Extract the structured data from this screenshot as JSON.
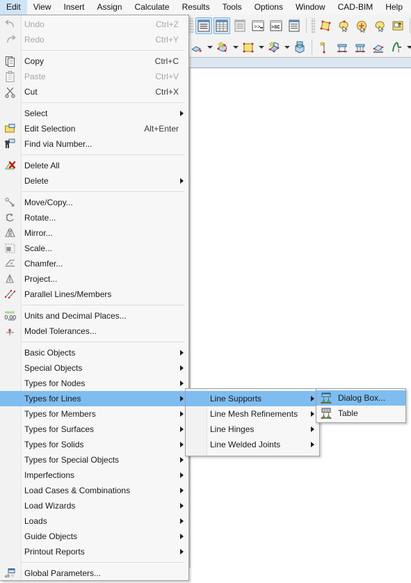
{
  "menubar": {
    "items": [
      {
        "label": "Edit",
        "active": true
      },
      {
        "label": "View",
        "active": false
      },
      {
        "label": "Insert",
        "active": false
      },
      {
        "label": "Assign",
        "active": false
      },
      {
        "label": "Calculate",
        "active": false
      },
      {
        "label": "Results",
        "active": false
      },
      {
        "label": "Tools",
        "active": false
      },
      {
        "label": "Options",
        "active": false
      },
      {
        "label": "Window",
        "active": false
      },
      {
        "label": "CAD-BIM",
        "active": false
      },
      {
        "label": "Help",
        "active": false
      }
    ]
  },
  "colors": {
    "menu_highlight": "#7fbdf0",
    "menubar_active": "#cfe4f7",
    "menu_background": "#f7f7f7",
    "toolbar_selected": "#d6eaf8",
    "ribbon_band": "#dce7f1",
    "disabled_text": "#a6a6a6"
  },
  "toolbar": {
    "row1": [
      {
        "name": "navigator-panel-button",
        "selected": true
      },
      {
        "name": "tables-panel-button",
        "selected": true
      },
      {
        "name": "display-properties-button",
        "selected": false
      },
      {
        "name": "command-line-button",
        "selected": false
      },
      {
        "name": "script-console-button",
        "selected": false
      },
      {
        "name": "printout-report-button",
        "selected": false
      },
      {
        "name": "select-area-button",
        "selected": false
      },
      {
        "name": "select-special-button",
        "selected": false
      },
      {
        "name": "select-objects-button",
        "selected": false
      },
      {
        "name": "deselect-button",
        "selected": false
      },
      {
        "name": "edit-selection-button",
        "selected": false
      },
      {
        "name": "new-support-button",
        "selected": false
      }
    ],
    "row2": [
      {
        "name": "new-node-button",
        "selected": false
      },
      {
        "name": "new-line-button",
        "selected": false
      },
      {
        "name": "new-surface-button",
        "selected": false
      },
      {
        "name": "new-member-button",
        "selected": false
      },
      {
        "name": "new-solid-button",
        "selected": false
      },
      {
        "name": "new-nodal-support-button",
        "selected": false
      },
      {
        "name": "new-line-support-button",
        "selected": false
      },
      {
        "name": "new-member-support-button",
        "selected": false
      },
      {
        "name": "new-surface-support-button",
        "selected": false
      },
      {
        "name": "new-hinge-button",
        "selected": false
      }
    ]
  },
  "edit_menu": {
    "groups": [
      {
        "items": [
          {
            "label": "Undo",
            "accel": "Ctrl+Z",
            "icon": "undo-icon",
            "disabled": true,
            "submenu": false
          },
          {
            "label": "Redo",
            "accel": "Ctrl+Y",
            "icon": "redo-icon",
            "disabled": true,
            "submenu": false
          }
        ]
      },
      {
        "items": [
          {
            "label": "Copy",
            "accel": "Ctrl+C",
            "icon": "copy-icon",
            "disabled": false,
            "submenu": false
          },
          {
            "label": "Paste",
            "accel": "Ctrl+V",
            "icon": "paste-icon",
            "disabled": true,
            "submenu": false
          },
          {
            "label": "Cut",
            "accel": "Ctrl+X",
            "icon": "cut-icon",
            "disabled": false,
            "submenu": false
          }
        ]
      },
      {
        "items": [
          {
            "label": "Select",
            "accel": "",
            "icon": "",
            "disabled": false,
            "submenu": true
          },
          {
            "label": "Edit Selection",
            "accel": "Alt+Enter",
            "icon": "edit-selection-icon",
            "disabled": false,
            "submenu": false
          },
          {
            "label": "Find via Number...",
            "accel": "",
            "icon": "find-via-number-icon",
            "disabled": false,
            "submenu": false
          }
        ]
      },
      {
        "items": [
          {
            "label": "Delete All",
            "accel": "",
            "icon": "delete-all-icon",
            "disabled": false,
            "submenu": false
          },
          {
            "label": "Delete",
            "accel": "",
            "icon": "",
            "disabled": false,
            "submenu": true
          }
        ]
      },
      {
        "items": [
          {
            "label": "Move/Copy...",
            "accel": "",
            "icon": "move-copy-icon",
            "disabled": false,
            "submenu": false
          },
          {
            "label": "Rotate...",
            "accel": "",
            "icon": "rotate-icon",
            "disabled": false,
            "submenu": false
          },
          {
            "label": "Mirror...",
            "accel": "",
            "icon": "mirror-icon",
            "disabled": false,
            "submenu": false
          },
          {
            "label": "Scale...",
            "accel": "",
            "icon": "scale-icon",
            "disabled": false,
            "submenu": false
          },
          {
            "label": "Chamfer...",
            "accel": "",
            "icon": "chamfer-icon",
            "disabled": false,
            "submenu": false
          },
          {
            "label": "Project...",
            "accel": "",
            "icon": "project-icon",
            "disabled": false,
            "submenu": false
          },
          {
            "label": "Parallel Lines/Members",
            "accel": "",
            "icon": "parallel-lines-icon",
            "disabled": false,
            "submenu": false
          }
        ]
      },
      {
        "items": [
          {
            "label": "Units and Decimal Places...",
            "accel": "",
            "icon": "units-decimal-icon",
            "disabled": false,
            "submenu": false
          },
          {
            "label": "Model Tolerances...",
            "accel": "",
            "icon": "model-tolerances-icon",
            "disabled": false,
            "submenu": false
          }
        ]
      },
      {
        "items": [
          {
            "label": "Basic Objects",
            "accel": "",
            "icon": "",
            "disabled": false,
            "submenu": true
          },
          {
            "label": "Special Objects",
            "accel": "",
            "icon": "",
            "disabled": false,
            "submenu": true
          },
          {
            "label": "Types for Nodes",
            "accel": "",
            "icon": "",
            "disabled": false,
            "submenu": true
          },
          {
            "label": "Types for Lines",
            "accel": "",
            "icon": "",
            "disabled": false,
            "submenu": true,
            "highlighted": true
          },
          {
            "label": "Types for Members",
            "accel": "",
            "icon": "",
            "disabled": false,
            "submenu": true
          },
          {
            "label": "Types for Surfaces",
            "accel": "",
            "icon": "",
            "disabled": false,
            "submenu": true
          },
          {
            "label": "Types for Solids",
            "accel": "",
            "icon": "",
            "disabled": false,
            "submenu": true
          },
          {
            "label": "Types for Special Objects",
            "accel": "",
            "icon": "",
            "disabled": false,
            "submenu": true
          },
          {
            "label": "Imperfections",
            "accel": "",
            "icon": "",
            "disabled": false,
            "submenu": true
          },
          {
            "label": "Load Cases & Combinations",
            "accel": "",
            "icon": "",
            "disabled": false,
            "submenu": true
          },
          {
            "label": "Load Wizards",
            "accel": "",
            "icon": "",
            "disabled": false,
            "submenu": true
          },
          {
            "label": "Loads",
            "accel": "",
            "icon": "",
            "disabled": false,
            "submenu": true
          },
          {
            "label": "Guide Objects",
            "accel": "",
            "icon": "",
            "disabled": false,
            "submenu": true
          },
          {
            "label": "Printout Reports",
            "accel": "",
            "icon": "",
            "disabled": false,
            "submenu": true
          }
        ]
      },
      {
        "items": [
          {
            "label": "Global Parameters...",
            "accel": "",
            "icon": "global-parameters-icon",
            "disabled": false,
            "submenu": false
          }
        ]
      }
    ]
  },
  "submenu_types_for_lines": {
    "items": [
      {
        "label": "Line Supports",
        "submenu": true,
        "highlighted": true
      },
      {
        "label": "Line Mesh Refinements",
        "submenu": true,
        "highlighted": false
      },
      {
        "label": "Line Hinges",
        "submenu": true,
        "highlighted": false
      },
      {
        "label": "Line Welded Joints",
        "submenu": true,
        "highlighted": false
      }
    ]
  },
  "submenu_line_supports": {
    "items": [
      {
        "label": "Dialog Box...",
        "icon": "line-support-dialog-icon",
        "highlighted": true
      },
      {
        "label": "Table",
        "icon": "line-support-table-icon",
        "highlighted": false
      }
    ]
  }
}
